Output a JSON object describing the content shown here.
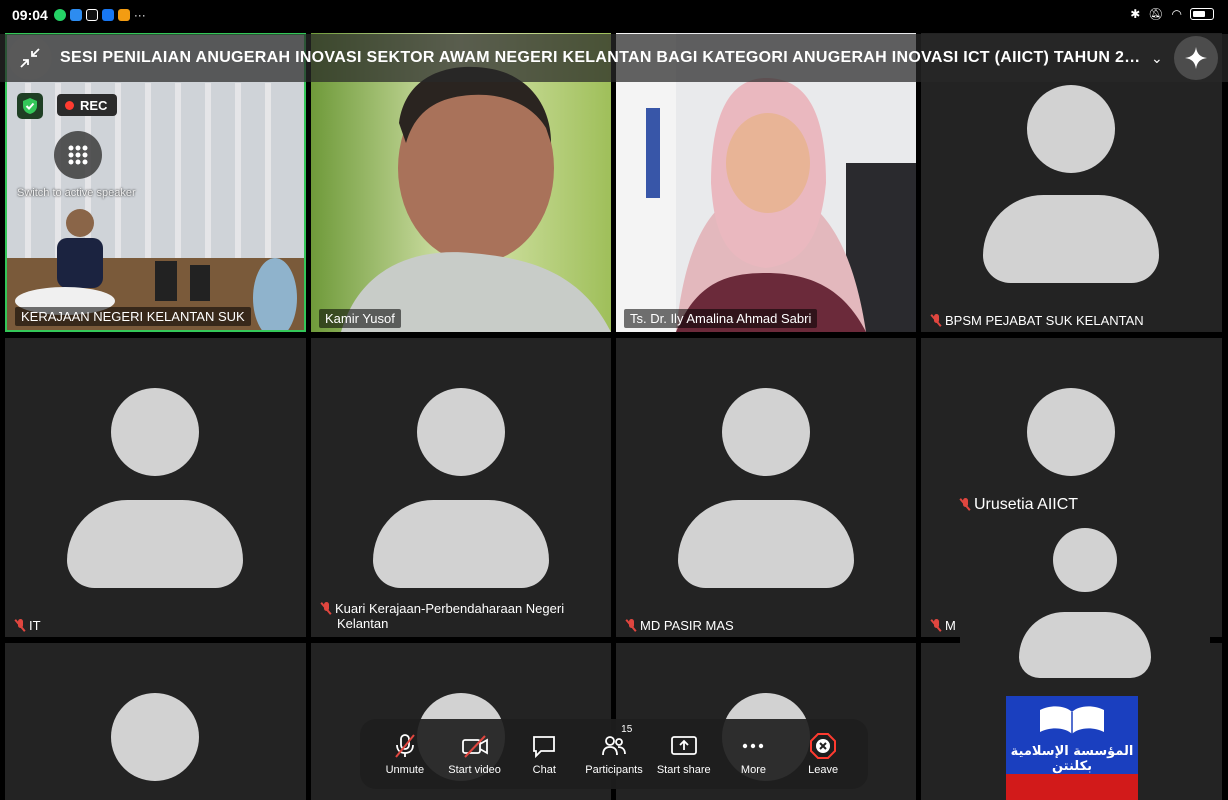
{
  "status_bar": {
    "time": "09:04",
    "more_indicator": "···"
  },
  "meeting": {
    "title": "SESI PENILAIAN ANUGERAH INOVASI SEKTOR AWAM NEGERI KELANTAN BAGI KATEGORI ANUGERAH INOVASI ICT (AIICT) TAHUN 20..."
  },
  "active_tile": {
    "rec_label": "REC",
    "switch_label": "Switch to active speaker"
  },
  "participants": [
    {
      "name": "KERAJAAN NEGERI KELANTAN SUK",
      "muted": false,
      "video": true
    },
    {
      "name": "Kamir Yusof",
      "muted": false,
      "video": true
    },
    {
      "name": "Ts. Dr. Ily Amalina Ahmad Sabri",
      "muted": false,
      "video": true
    },
    {
      "name": "BPSM PEJABAT SUK KELANTAN",
      "muted": true,
      "video": false
    },
    {
      "name": "IT",
      "muted": true,
      "video": false
    },
    {
      "name": "Kuari Kerajaan-Perbendaharaan Negeri",
      "name_line2": "Kelantan",
      "muted": true,
      "video": false
    },
    {
      "name": "MD PASIR MAS",
      "muted": true,
      "video": false
    },
    {
      "name": "M",
      "muted": true,
      "video": false
    }
  ],
  "self_view": {
    "name": "Urusetia AIICT",
    "muted": true,
    "logo_text": "المؤسسة الإسلامية بكلنتن"
  },
  "toolbar": {
    "unmute": "Unmute",
    "start_video": "Start video",
    "chat": "Chat",
    "participants": "Participants",
    "participants_count": "15",
    "start_share": "Start share",
    "more": "More",
    "leave": "Leave"
  },
  "colors": {
    "active_border": "#34c759",
    "mute_red": "#e0463f",
    "leave_red": "#ff3b30",
    "tile_bg": "#232323"
  }
}
